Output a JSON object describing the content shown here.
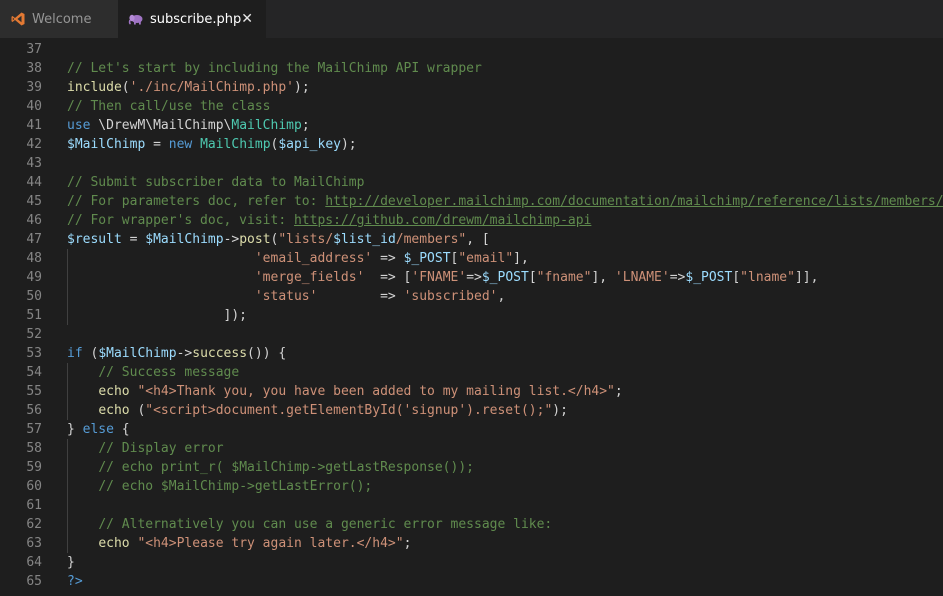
{
  "tabs": [
    {
      "label": "Welcome",
      "icon": "vscode-logo-icon",
      "active": false
    },
    {
      "label": "subscribe.php",
      "icon": "php-elephant-icon",
      "active": true,
      "close": "✕"
    }
  ],
  "colors": {
    "background": "#1e1e1e",
    "comment": "#608b4e",
    "keyword": "#569cd6",
    "variable": "#9cdcfe",
    "string": "#ce9178",
    "function": "#dcdcaa",
    "class": "#4ec9b0",
    "default": "#d4d4d4",
    "line_number": "#858585"
  },
  "editor": {
    "lines": [
      {
        "n": "37",
        "tokens": []
      },
      {
        "n": "38",
        "tokens": [
          [
            "com",
            "// Let's start by including the MailChimp API wrapper"
          ]
        ]
      },
      {
        "n": "39",
        "tokens": [
          [
            "fn",
            "include"
          ],
          [
            "def",
            "("
          ],
          [
            "str",
            "'./inc/MailChimp.php'"
          ],
          [
            "def",
            ");"
          ]
        ]
      },
      {
        "n": "40",
        "tokens": [
          [
            "com",
            "// Then call/use the class"
          ]
        ]
      },
      {
        "n": "41",
        "tokens": [
          [
            "kw",
            "use"
          ],
          [
            "def",
            " \\DrewM\\MailChimp\\"
          ],
          [
            "cls",
            "MailChimp"
          ],
          [
            "def",
            ";"
          ]
        ]
      },
      {
        "n": "42",
        "tokens": [
          [
            "var",
            "$MailChimp"
          ],
          [
            "def",
            " = "
          ],
          [
            "kw",
            "new"
          ],
          [
            "def",
            " "
          ],
          [
            "cls",
            "MailChimp"
          ],
          [
            "def",
            "("
          ],
          [
            "var",
            "$api_key"
          ],
          [
            "def",
            ");"
          ]
        ]
      },
      {
        "n": "43",
        "tokens": []
      },
      {
        "n": "44",
        "tokens": [
          [
            "com",
            "// Submit subscriber data to MailChimp"
          ]
        ]
      },
      {
        "n": "45",
        "tokens": [
          [
            "com",
            "// For parameters doc, refer to: "
          ],
          [
            "lnk",
            "http://developer.mailchimp.com/documentation/mailchimp/reference/lists/members/"
          ]
        ]
      },
      {
        "n": "46",
        "tokens": [
          [
            "com",
            "// For wrapper's doc, visit: "
          ],
          [
            "lnk",
            "https://github.com/drewm/mailchimp-api"
          ]
        ]
      },
      {
        "n": "47",
        "tokens": [
          [
            "var",
            "$result"
          ],
          [
            "def",
            " = "
          ],
          [
            "var",
            "$MailChimp"
          ],
          [
            "def",
            "->"
          ],
          [
            "fn",
            "post"
          ],
          [
            "def",
            "("
          ],
          [
            "str",
            "\"lists/"
          ],
          [
            "var",
            "$list_id"
          ],
          [
            "str",
            "/members\""
          ],
          [
            "def",
            ", ["
          ]
        ]
      },
      {
        "n": "48",
        "tokens": [
          [
            "def",
            "                        "
          ],
          [
            "str",
            "'email_address'"
          ],
          [
            "def",
            " => "
          ],
          [
            "var",
            "$_POST"
          ],
          [
            "def",
            "["
          ],
          [
            "str",
            "\"email\""
          ],
          [
            "def",
            "],"
          ]
        ]
      },
      {
        "n": "49",
        "tokens": [
          [
            "def",
            "                        "
          ],
          [
            "str",
            "'merge_fields'"
          ],
          [
            "def",
            "  => ["
          ],
          [
            "str",
            "'FNAME'"
          ],
          [
            "def",
            "=>"
          ],
          [
            "var",
            "$_POST"
          ],
          [
            "def",
            "["
          ],
          [
            "str",
            "\"fname\""
          ],
          [
            "def",
            "], "
          ],
          [
            "str",
            "'LNAME'"
          ],
          [
            "def",
            "=>"
          ],
          [
            "var",
            "$_POST"
          ],
          [
            "def",
            "["
          ],
          [
            "str",
            "\"lname\""
          ],
          [
            "def",
            "]],"
          ]
        ]
      },
      {
        "n": "50",
        "tokens": [
          [
            "def",
            "                        "
          ],
          [
            "str",
            "'status'"
          ],
          [
            "def",
            "        => "
          ],
          [
            "str",
            "'subscribed'"
          ],
          [
            "def",
            ","
          ]
        ]
      },
      {
        "n": "51",
        "tokens": [
          [
            "def",
            "                    ]);"
          ]
        ]
      },
      {
        "n": "52",
        "tokens": []
      },
      {
        "n": "53",
        "tokens": [
          [
            "kw",
            "if"
          ],
          [
            "def",
            " ("
          ],
          [
            "var",
            "$MailChimp"
          ],
          [
            "def",
            "->"
          ],
          [
            "fn",
            "success"
          ],
          [
            "def",
            "()) {"
          ]
        ]
      },
      {
        "n": "54",
        "tokens": [
          [
            "def",
            "    "
          ],
          [
            "com",
            "// Success message"
          ]
        ]
      },
      {
        "n": "55",
        "tokens": [
          [
            "def",
            "    "
          ],
          [
            "fn",
            "echo"
          ],
          [
            "def",
            " "
          ],
          [
            "str",
            "\"<h4>Thank you, you have been added to my mailing list.</h4>\""
          ],
          [
            "def",
            ";"
          ]
        ]
      },
      {
        "n": "56",
        "tokens": [
          [
            "def",
            "    "
          ],
          [
            "fn",
            "echo"
          ],
          [
            "def",
            " ("
          ],
          [
            "str",
            "\"<script>document.getElementById('signup').reset();\""
          ],
          [
            "def",
            ");"
          ]
        ]
      },
      {
        "n": "57",
        "tokens": [
          [
            "def",
            "} "
          ],
          [
            "kw",
            "else"
          ],
          [
            "def",
            " {"
          ]
        ]
      },
      {
        "n": "58",
        "tokens": [
          [
            "def",
            "    "
          ],
          [
            "com",
            "// Display error"
          ]
        ]
      },
      {
        "n": "59",
        "tokens": [
          [
            "def",
            "    "
          ],
          [
            "com",
            "// echo print_r( $MailChimp->getLastResponse());"
          ]
        ]
      },
      {
        "n": "60",
        "tokens": [
          [
            "def",
            "    "
          ],
          [
            "com",
            "// echo $MailChimp->getLastError();"
          ]
        ]
      },
      {
        "n": "61",
        "tokens": []
      },
      {
        "n": "62",
        "tokens": [
          [
            "def",
            "    "
          ],
          [
            "com",
            "// Alternatively you can use a generic error message like:"
          ]
        ]
      },
      {
        "n": "63",
        "tokens": [
          [
            "def",
            "    "
          ],
          [
            "fn",
            "echo"
          ],
          [
            "def",
            " "
          ],
          [
            "str",
            "\"<h4>Please try again later.</h4>\""
          ],
          [
            "def",
            ";"
          ]
        ]
      },
      {
        "n": "64",
        "tokens": [
          [
            "def",
            "}"
          ]
        ]
      },
      {
        "n": "65",
        "tokens": [
          [
            "kw",
            "?>"
          ]
        ]
      }
    ]
  }
}
